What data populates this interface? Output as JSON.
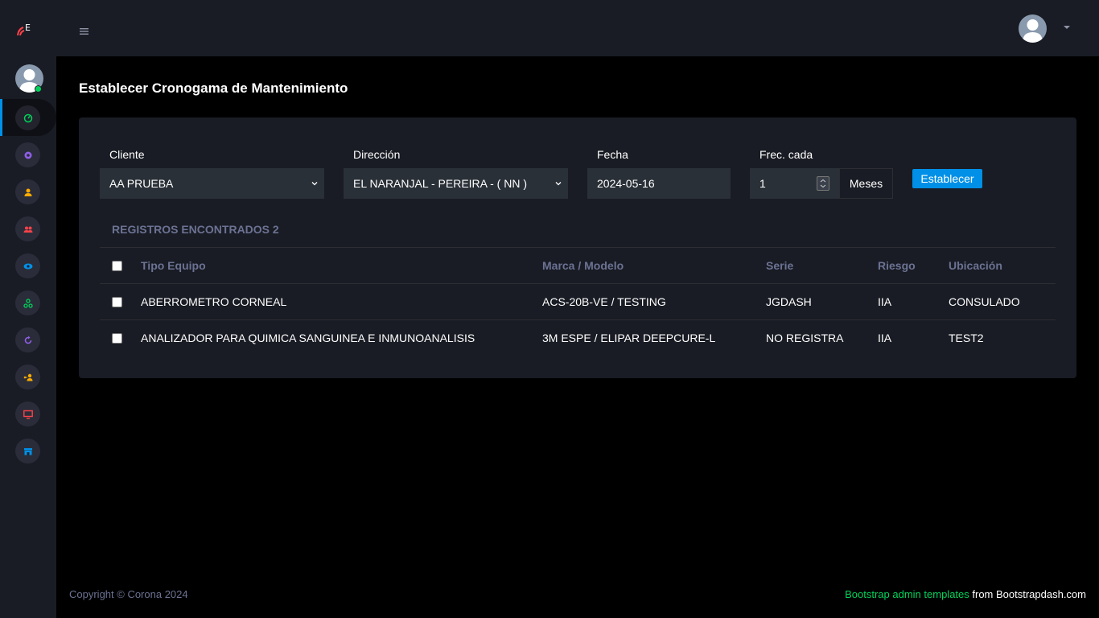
{
  "brand": {
    "logo_letter": "E",
    "colors": {
      "accent": "#0090e7",
      "success": "#00d25b"
    }
  },
  "topbar": {
    "menu_icon": "hamburger-icon",
    "avatar": "user-avatar",
    "dropdown_icon": "caret-down-icon"
  },
  "sidebar": {
    "items": [
      {
        "name": "dashboard",
        "icon": "speedometer-icon",
        "color": "#00d25b"
      },
      {
        "name": "settings",
        "icon": "gear-icon",
        "color": "#8f5fe8"
      },
      {
        "name": "user",
        "icon": "user-icon",
        "color": "#ffab00"
      },
      {
        "name": "users",
        "icon": "users-icon",
        "color": "#fc424a"
      },
      {
        "name": "view",
        "icon": "eye-icon",
        "color": "#0090e7"
      },
      {
        "name": "network",
        "icon": "network-icon",
        "color": "#00d25b"
      },
      {
        "name": "refresh",
        "icon": "refresh-icon",
        "color": "#8f5fe8"
      },
      {
        "name": "user-key",
        "icon": "user-key-icon",
        "color": "#ffab00"
      },
      {
        "name": "monitor",
        "icon": "monitor-icon",
        "color": "#fc424a"
      },
      {
        "name": "store",
        "icon": "store-icon",
        "color": "#0090e7"
      }
    ]
  },
  "page": {
    "title": "Establecer Cronogama de Mantenimiento"
  },
  "form": {
    "cliente": {
      "label": "Cliente",
      "value": "AA PRUEBA"
    },
    "direccion": {
      "label": "Dirección",
      "value": "EL NARANJAL - PEREIRA - ( NN )"
    },
    "fecha": {
      "label": "Fecha",
      "value": "2024-05-16"
    },
    "frecuencia": {
      "label": "Frec. cada",
      "value": "1",
      "unit": "Meses"
    },
    "submit_label": "Establecer"
  },
  "table": {
    "count_label": "REGISTROS ENCONTRADOS 2",
    "headers": [
      "Tipo Equipo",
      "Marca / Modelo",
      "Serie",
      "Riesgo",
      "Ubicación"
    ],
    "rows": [
      [
        "ABERROMETRO CORNEAL",
        "ACS-20B-VE / TESTING",
        "JGDASH",
        "IIA",
        "CONSULADO"
      ],
      [
        "ANALIZADOR PARA QUIMICA SANGUINEA E INMUNOANALISIS",
        "3M ESPE / ELIPAR DEEPCURE-L",
        "NO REGISTRA",
        "IIA",
        "TEST2"
      ]
    ]
  },
  "footer": {
    "copyright": "Copyright © Corona 2024",
    "link_text": "Bootstrap admin templates",
    "suffix": " from Bootstrapdash.com"
  }
}
